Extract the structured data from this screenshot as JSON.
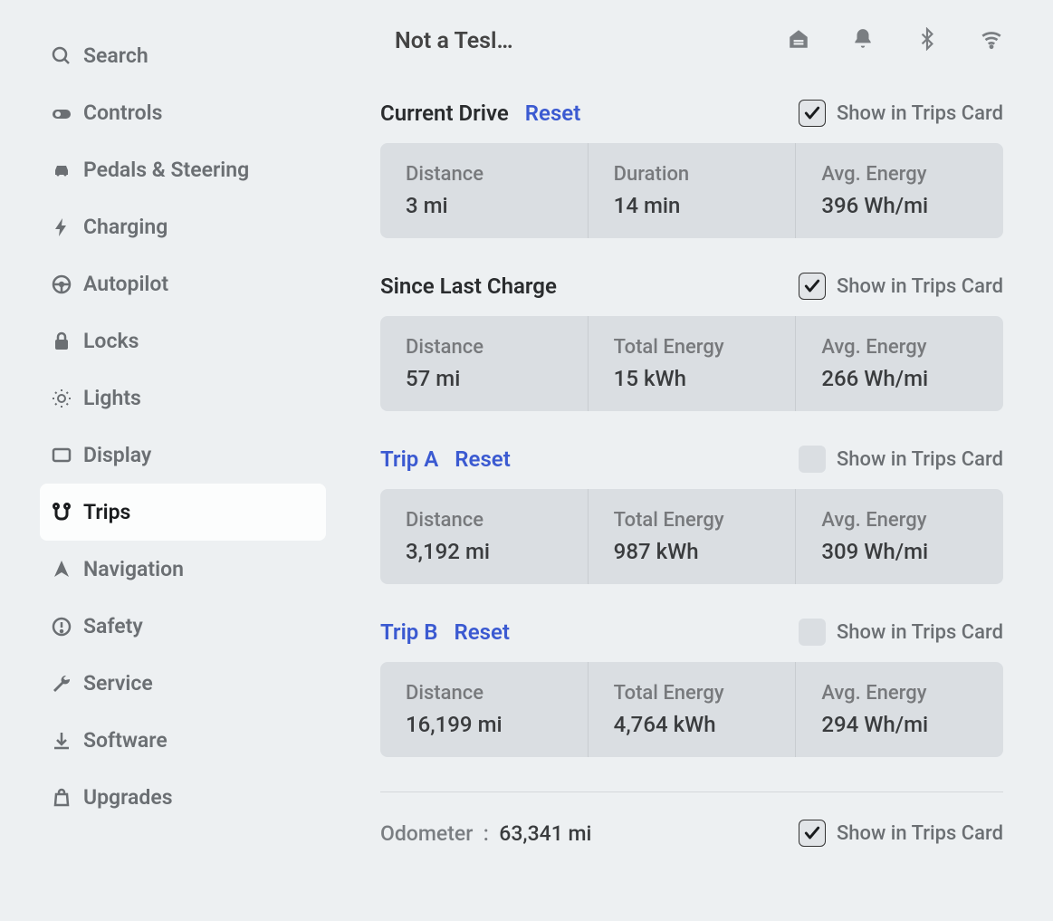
{
  "sidebar": {
    "items": [
      {
        "label": "Search",
        "icon": "search"
      },
      {
        "label": "Controls",
        "icon": "toggle"
      },
      {
        "label": "Pedals & Steering",
        "icon": "car"
      },
      {
        "label": "Charging",
        "icon": "bolt"
      },
      {
        "label": "Autopilot",
        "icon": "steering"
      },
      {
        "label": "Locks",
        "icon": "lock"
      },
      {
        "label": "Lights",
        "icon": "bulb"
      },
      {
        "label": "Display",
        "icon": "display"
      },
      {
        "label": "Trips",
        "icon": "route"
      },
      {
        "label": "Navigation",
        "icon": "arrow"
      },
      {
        "label": "Safety",
        "icon": "warning"
      },
      {
        "label": "Service",
        "icon": "wrench"
      },
      {
        "label": "Software",
        "icon": "download"
      },
      {
        "label": "Upgrades",
        "icon": "bag"
      }
    ],
    "active_index": 8
  },
  "header": {
    "profile_name": "Not a Tesl…",
    "status_icons": [
      "garage",
      "bell",
      "bluetooth",
      "wifi"
    ]
  },
  "sections": [
    {
      "title": "Current Drive",
      "title_link": false,
      "reset": "Reset",
      "show_in_card_label": "Show in Trips Card",
      "show_in_card": true,
      "stats": [
        {
          "label": "Distance",
          "value": "3",
          "unit": "mi"
        },
        {
          "label": "Duration",
          "value": "14",
          "unit": "min"
        },
        {
          "label": "Avg. Energy",
          "value": "396",
          "unit": "Wh/mi"
        }
      ]
    },
    {
      "title": "Since Last Charge",
      "title_link": false,
      "reset": null,
      "show_in_card_label": "Show in Trips Card",
      "show_in_card": true,
      "stats": [
        {
          "label": "Distance",
          "value": "57",
          "unit": "mi"
        },
        {
          "label": "Total Energy",
          "value": "15",
          "unit": "kWh"
        },
        {
          "label": "Avg. Energy",
          "value": "266",
          "unit": "Wh/mi"
        }
      ]
    },
    {
      "title": "Trip A",
      "title_link": true,
      "reset": "Reset",
      "show_in_card_label": "Show in Trips Card",
      "show_in_card": false,
      "stats": [
        {
          "label": "Distance",
          "value": "3,192",
          "unit": "mi"
        },
        {
          "label": "Total Energy",
          "value": "987",
          "unit": "kWh"
        },
        {
          "label": "Avg. Energy",
          "value": "309",
          "unit": "Wh/mi"
        }
      ]
    },
    {
      "title": "Trip B",
      "title_link": true,
      "reset": "Reset",
      "show_in_card_label": "Show in Trips Card",
      "show_in_card": false,
      "stats": [
        {
          "label": "Distance",
          "value": "16,199",
          "unit": "mi"
        },
        {
          "label": "Total Energy",
          "value": "4,764",
          "unit": "kWh"
        },
        {
          "label": "Avg. Energy",
          "value": "294",
          "unit": "Wh/mi"
        }
      ]
    }
  ],
  "odometer": {
    "label": "Odometer",
    "sep": ":",
    "value": "63,341",
    "unit": "mi",
    "show_in_card_label": "Show in Trips Card",
    "show_in_card": true
  }
}
